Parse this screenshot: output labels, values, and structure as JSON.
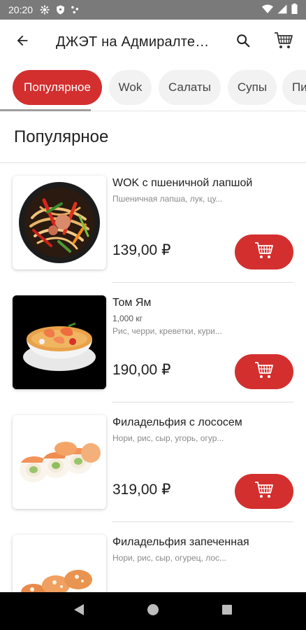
{
  "status_bar": {
    "time": "20:20"
  },
  "app_bar": {
    "title": "ДЖЭТ на Адмиралтейской"
  },
  "tabs": [
    {
      "label": "Популярное",
      "active": true
    },
    {
      "label": "Wok",
      "active": false
    },
    {
      "label": "Салаты",
      "active": false
    },
    {
      "label": "Супы",
      "active": false
    },
    {
      "label": "Пи",
      "active": false
    }
  ],
  "section": {
    "title": "Популярное"
  },
  "products": [
    {
      "name": "WOK с пшеничной лапшой",
      "weight": "",
      "description": "Пшеничная лапша, лук, цу...",
      "price": "139,00 ₽"
    },
    {
      "name": "Том Ям",
      "weight": "1,000 кг",
      "description": "Рис, черри, креветки, кури...",
      "price": "190,00 ₽"
    },
    {
      "name": "Филадельфия с лососем",
      "weight": "",
      "description": "Нори, рис, сыр, угорь, огур...",
      "price": "319,00 ₽"
    },
    {
      "name": "Филадельфия запеченная",
      "weight": "",
      "description": "Нори, рис, сыр, огурец, лос...",
      "price": ""
    }
  ],
  "colors": {
    "accent": "#d32f2f",
    "status_bar": "#7a7a7a",
    "chip_bg": "#f2f2f2"
  },
  "icons": {
    "back": "arrow-left-icon",
    "search": "search-icon",
    "cart": "cart-icon",
    "add_to_cart": "cart-add-icon",
    "nav_back": "triangle-back-icon",
    "nav_home": "circle-home-icon",
    "nav_recents": "square-recents-icon"
  }
}
